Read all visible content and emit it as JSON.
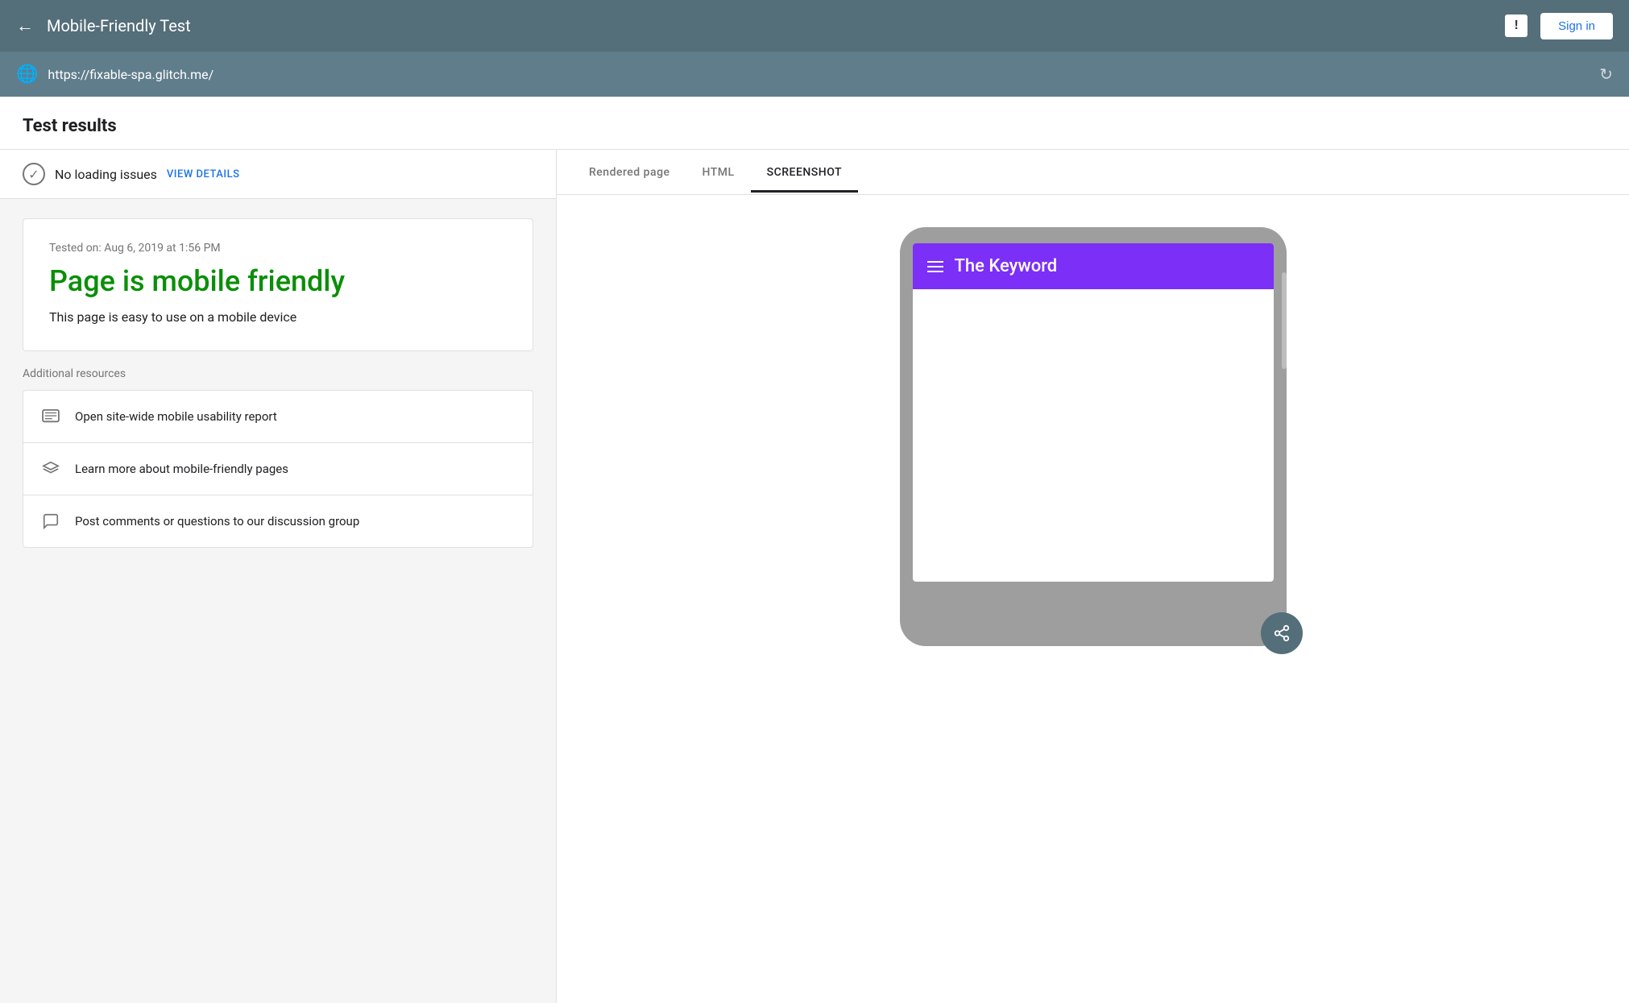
{
  "topNav": {
    "backLabel": "←",
    "title": "Mobile-Friendly Test",
    "feedbackIconLabel": "!",
    "signInLabel": "Sign in"
  },
  "urlBar": {
    "url": "https://fixable-spa.glitch.me/",
    "globeIcon": "🌐",
    "refreshIcon": "↻"
  },
  "content": {
    "testResultsTitle": "Test results"
  },
  "leftPanel": {
    "statusBar": {
      "noLoadingText": "No loading issues",
      "viewDetailsLabel": "VIEW DETAILS"
    },
    "resultCard": {
      "testedOn": "Tested on: Aug 6, 2019 at 1:56 PM",
      "mobileFriendlyTitle": "Page is mobile friendly",
      "description": "This page is easy to use on a mobile device"
    },
    "additionalResources": {
      "sectionTitle": "Additional resources",
      "items": [
        {
          "icon": "📋",
          "text": "Open site-wide mobile usability report"
        },
        {
          "icon": "🎓",
          "text": "Learn more about mobile-friendly pages"
        },
        {
          "icon": "💬",
          "text": "Post comments or questions to our discussion group"
        }
      ]
    }
  },
  "rightPanel": {
    "tabs": [
      {
        "label": "Rendered page",
        "active": false
      },
      {
        "label": "HTML",
        "active": false
      },
      {
        "label": "SCREENSHOT",
        "active": true
      }
    ],
    "phoneMockup": {
      "headerBgColor": "#7b2ff7",
      "siteTitle": "The Keyword"
    }
  },
  "colors": {
    "navBg": "#546e7a",
    "urlBarBg": "#607d8b",
    "mobileFriendlyGreen": "#0a8f08",
    "accent": "#1a73e8"
  }
}
